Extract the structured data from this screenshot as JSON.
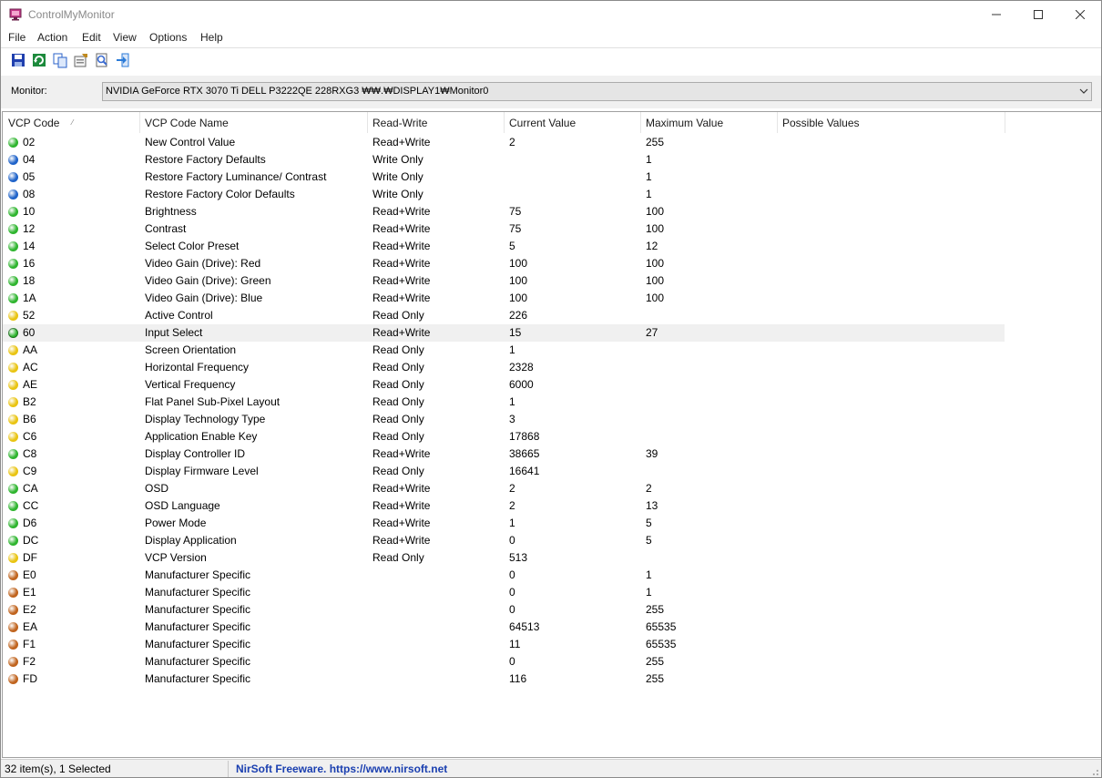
{
  "app": {
    "title": "ControlMyMonitor"
  },
  "menu": [
    "File",
    "Action",
    "Edit",
    "View",
    "Options",
    "Help"
  ],
  "toolbar": [
    {
      "icon": "save-icon",
      "color": "#1f3fae"
    },
    {
      "icon": "refresh-icon",
      "color": "#1c8a3c"
    },
    {
      "icon": "copy-icon",
      "color": "#2a62c9"
    },
    {
      "icon": "properties-icon",
      "color": "#c08a1e"
    },
    {
      "icon": "find-icon",
      "color": "#3a6ad0"
    },
    {
      "icon": "exit-icon",
      "color": "#2b7bd8"
    }
  ],
  "monitor": {
    "label": "Monitor:",
    "value": "NVIDIA GeForce RTX 3070 Ti  DELL P3222QE  228RXG3  ₩₩.₩DISPLAY1₩Monitor0"
  },
  "columns": [
    "VCP Code",
    "VCP Code Name",
    "Read-Write",
    "Current Value",
    "Maximum Value",
    "Possible Values"
  ],
  "status_colors": {
    "rw": "#2fb52f",
    "wo": "#1f63c9",
    "ro": "#e9c412",
    "ms": "#c0641e"
  },
  "rows": [
    {
      "code": "02",
      "name": "New Control Value",
      "rw": "Read+Write",
      "cur": "2",
      "max": "255",
      "poss": "",
      "status": "rw"
    },
    {
      "code": "04",
      "name": "Restore Factory Defaults",
      "rw": "Write Only",
      "cur": "",
      "max": "1",
      "poss": "",
      "status": "wo"
    },
    {
      "code": "05",
      "name": "Restore Factory Luminance/ Contrast",
      "rw": "Write Only",
      "cur": "",
      "max": "1",
      "poss": "",
      "status": "wo"
    },
    {
      "code": "08",
      "name": "Restore Factory Color Defaults",
      "rw": "Write Only",
      "cur": "",
      "max": "1",
      "poss": "",
      "status": "wo"
    },
    {
      "code": "10",
      "name": "Brightness",
      "rw": "Read+Write",
      "cur": "75",
      "max": "100",
      "poss": "",
      "status": "rw"
    },
    {
      "code": "12",
      "name": "Contrast",
      "rw": "Read+Write",
      "cur": "75",
      "max": "100",
      "poss": "",
      "status": "rw"
    },
    {
      "code": "14",
      "name": "Select Color Preset",
      "rw": "Read+Write",
      "cur": "5",
      "max": "12",
      "poss": "",
      "status": "rw"
    },
    {
      "code": "16",
      "name": "Video Gain (Drive): Red",
      "rw": "Read+Write",
      "cur": "100",
      "max": "100",
      "poss": "",
      "status": "rw"
    },
    {
      "code": "18",
      "name": "Video Gain (Drive): Green",
      "rw": "Read+Write",
      "cur": "100",
      "max": "100",
      "poss": "",
      "status": "rw"
    },
    {
      "code": "1A",
      "name": "Video Gain (Drive): Blue",
      "rw": "Read+Write",
      "cur": "100",
      "max": "100",
      "poss": "",
      "status": "rw"
    },
    {
      "code": "52",
      "name": "Active Control",
      "rw": "Read Only",
      "cur": "226",
      "max": "",
      "poss": "",
      "status": "ro"
    },
    {
      "code": "60",
      "name": "Input Select",
      "rw": "Read+Write",
      "cur": "15",
      "max": "27",
      "poss": "",
      "status": "rw",
      "selected": true
    },
    {
      "code": "AA",
      "name": "Screen Orientation",
      "rw": "Read Only",
      "cur": "1",
      "max": "",
      "poss": "",
      "status": "ro"
    },
    {
      "code": "AC",
      "name": "Horizontal Frequency",
      "rw": "Read Only",
      "cur": "2328",
      "max": "",
      "poss": "",
      "status": "ro"
    },
    {
      "code": "AE",
      "name": "Vertical Frequency",
      "rw": "Read Only",
      "cur": "6000",
      "max": "",
      "poss": "",
      "status": "ro"
    },
    {
      "code": "B2",
      "name": "Flat Panel Sub-Pixel Layout",
      "rw": "Read Only",
      "cur": "1",
      "max": "",
      "poss": "",
      "status": "ro"
    },
    {
      "code": "B6",
      "name": "Display Technology Type",
      "rw": "Read Only",
      "cur": "3",
      "max": "",
      "poss": "",
      "status": "ro"
    },
    {
      "code": "C6",
      "name": "Application Enable Key",
      "rw": "Read Only",
      "cur": "17868",
      "max": "",
      "poss": "",
      "status": "ro"
    },
    {
      "code": "C8",
      "name": "Display Controller ID",
      "rw": "Read+Write",
      "cur": "38665",
      "max": "39",
      "poss": "",
      "status": "rw"
    },
    {
      "code": "C9",
      "name": "Display Firmware Level",
      "rw": "Read Only",
      "cur": "16641",
      "max": "",
      "poss": "",
      "status": "ro"
    },
    {
      "code": "CA",
      "name": "OSD",
      "rw": "Read+Write",
      "cur": "2",
      "max": "2",
      "poss": "",
      "status": "rw"
    },
    {
      "code": "CC",
      "name": "OSD Language",
      "rw": "Read+Write",
      "cur": "2",
      "max": "13",
      "poss": "",
      "status": "rw"
    },
    {
      "code": "D6",
      "name": "Power Mode",
      "rw": "Read+Write",
      "cur": "1",
      "max": "5",
      "poss": "",
      "status": "rw"
    },
    {
      "code": "DC",
      "name": "Display Application",
      "rw": "Read+Write",
      "cur": "0",
      "max": "5",
      "poss": "",
      "status": "rw"
    },
    {
      "code": "DF",
      "name": "VCP Version",
      "rw": "Read Only",
      "cur": "513",
      "max": "",
      "poss": "",
      "status": "ro"
    },
    {
      "code": "E0",
      "name": "Manufacturer Specific",
      "rw": "",
      "cur": "0",
      "max": "1",
      "poss": "",
      "status": "ms"
    },
    {
      "code": "E1",
      "name": "Manufacturer Specific",
      "rw": "",
      "cur": "0",
      "max": "1",
      "poss": "",
      "status": "ms"
    },
    {
      "code": "E2",
      "name": "Manufacturer Specific",
      "rw": "",
      "cur": "0",
      "max": "255",
      "poss": "",
      "status": "ms"
    },
    {
      "code": "EA",
      "name": "Manufacturer Specific",
      "rw": "",
      "cur": "64513",
      "max": "65535",
      "poss": "",
      "status": "ms"
    },
    {
      "code": "F1",
      "name": "Manufacturer Specific",
      "rw": "",
      "cur": "11",
      "max": "65535",
      "poss": "",
      "status": "ms"
    },
    {
      "code": "F2",
      "name": "Manufacturer Specific",
      "rw": "",
      "cur": "0",
      "max": "255",
      "poss": "",
      "status": "ms"
    },
    {
      "code": "FD",
      "name": "Manufacturer Specific",
      "rw": "",
      "cur": "116",
      "max": "255",
      "poss": "",
      "status": "ms"
    }
  ],
  "status": {
    "left": "32 item(s), 1 Selected",
    "right": "NirSoft Freeware. https://www.nirsoft.net"
  }
}
